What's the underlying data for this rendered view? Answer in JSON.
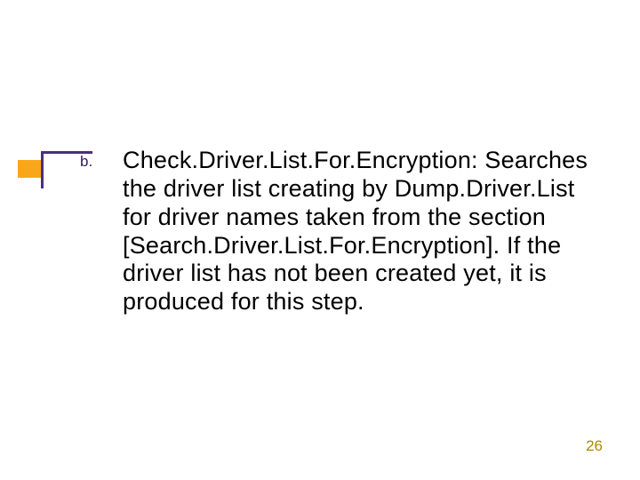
{
  "slide": {
    "list_marker": "b.",
    "body_text": "Check.Driver.List.For.Encryption: Searches the driver list creating by Dump.Driver.List for driver names taken from the section [Search.Driver.List.For.Encryption]. If the driver list has not been created yet, it is produced for this step.",
    "page_number": "26"
  }
}
